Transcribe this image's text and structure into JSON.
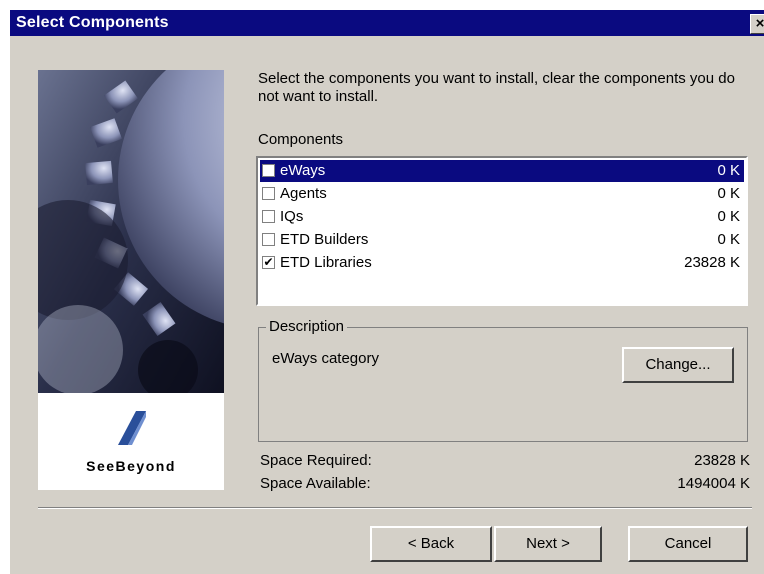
{
  "dialog": {
    "title": "Select Components",
    "close_glyph": "×"
  },
  "branding": {
    "logo_text": "SeeBeyond",
    "logo_icon": "seebeyond-logo-icon",
    "artwork": "gears-artwork"
  },
  "instructions": "Select the components you want to install, clear the components you do not want to install.",
  "components_label": "Components",
  "components": [
    {
      "name": "eWays",
      "size": "0 K",
      "checked": false,
      "selected": true
    },
    {
      "name": "Agents",
      "size": "0 K",
      "checked": false,
      "selected": false
    },
    {
      "name": "IQs",
      "size": "0 K",
      "checked": false,
      "selected": false
    },
    {
      "name": "ETD Builders",
      "size": "0 K",
      "checked": false,
      "selected": false
    },
    {
      "name": "ETD Libraries",
      "size": "23828 K",
      "checked": true,
      "selected": false
    }
  ],
  "description": {
    "group_label": "Description",
    "text": "eWays category",
    "change_button": "Change..."
  },
  "space": {
    "required_label": "Space Required:",
    "required_value": "23828 K",
    "available_label": "Space Available:",
    "available_value": "1494004 K"
  },
  "buttons": {
    "back": "< Back",
    "next": "Next >",
    "cancel": "Cancel"
  },
  "colors": {
    "titlebar": "#0a0a80",
    "face": "#d4d0c8",
    "selection": "#0a0a80"
  }
}
